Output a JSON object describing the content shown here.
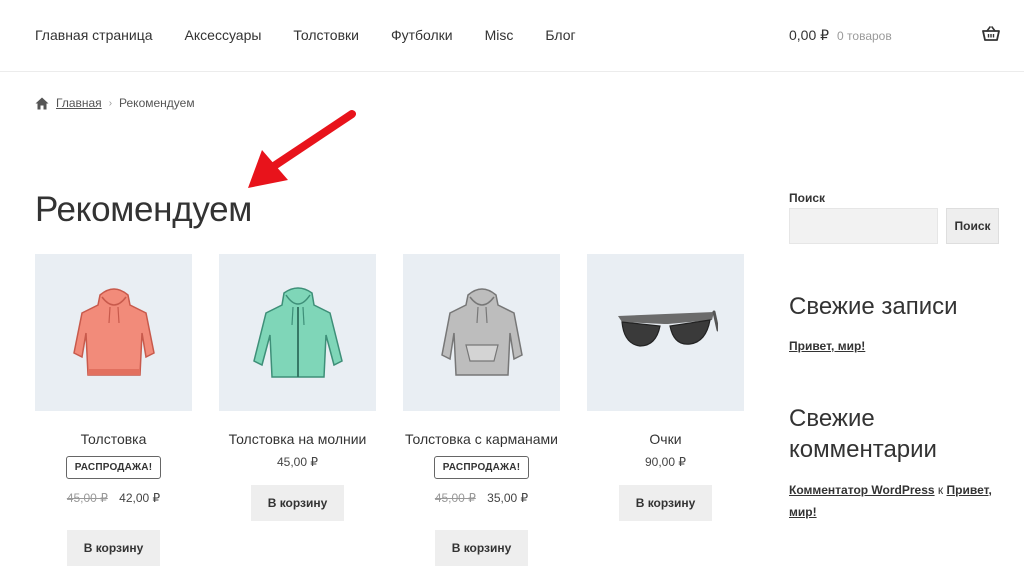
{
  "nav": {
    "items": [
      "Главная страница",
      "Аксессуары",
      "Толстовки",
      "Футболки",
      "Misc",
      "Блог"
    ]
  },
  "cart": {
    "amount": "0,00 ₽",
    "count": "0 товаров",
    "icon": "basket-icon"
  },
  "breadcrumb": {
    "home_icon": "home-icon",
    "home": "Главная",
    "separator": "›",
    "current": "Рекомендуем"
  },
  "page": {
    "title": "Рекомендуем"
  },
  "annotation": {
    "arrow_color": "#e8131b"
  },
  "products": [
    {
      "name": "Толстовка",
      "badge": "РАСПРОДАЖА!",
      "old_price": "45,00 ₽",
      "price": "42,00 ₽",
      "button": "В корзину",
      "image": "hoodie-orange",
      "color": "#f28b7a"
    },
    {
      "name": "Толстовка на молнии",
      "price": "45,00 ₽",
      "button": "В корзину",
      "image": "zip-hoodie-mint",
      "color": "#7fd6b8"
    },
    {
      "name": "Толстовка с карманами",
      "badge": "РАСПРОДАЖА!",
      "old_price": "45,00 ₽",
      "price": "35,00 ₽",
      "button": "В корзину",
      "image": "hoodie-gray",
      "color": "#b9b9b9"
    },
    {
      "name": "Очки",
      "price": "90,00 ₽",
      "button": "В корзину",
      "image": "sunglasses",
      "color": "#6b6b6b"
    }
  ],
  "sidebar": {
    "search_label": "Поиск",
    "search_placeholder": "",
    "search_button": "Поиск",
    "recent_posts_title": "Свежие записи",
    "recent_post": "Привет, мир!",
    "recent_comments_title_1": "Свежие",
    "recent_comments_title_2": "комментарии",
    "comment_author": "Комментатор WordPress",
    "comment_on": "к",
    "comment_post": "Привет, мир!"
  }
}
